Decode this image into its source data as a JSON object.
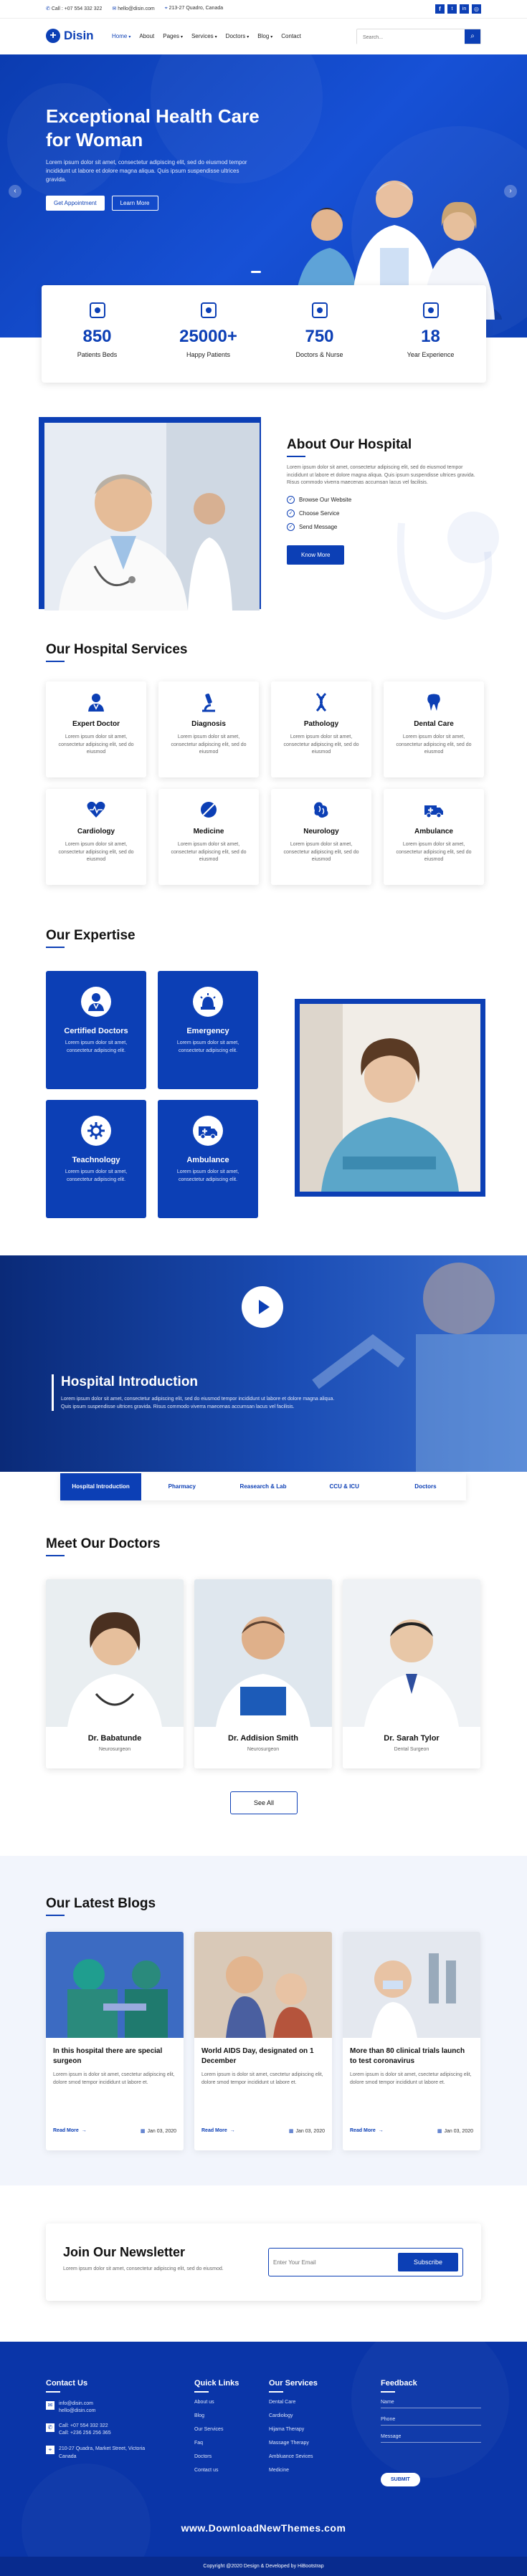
{
  "topbar": {
    "phone": "Call : +07 554 332 322",
    "email": "hello@disin.com",
    "address": "213-27 Quadro, Canada"
  },
  "nav": {
    "logo": "Disin",
    "items": [
      "Home",
      "About",
      "Pages",
      "Services",
      "Doctors",
      "Blog",
      "Contact"
    ],
    "dropdowns": [
      true,
      false,
      true,
      true,
      true,
      true,
      false
    ],
    "search_placeholder": "Search..."
  },
  "hero": {
    "title_line1": "Exceptional Health Care",
    "title_line2": "for Woman",
    "text": "Lorem ipsum dolor sit amet, consectetur adipiscing elit, sed do eiusmod tempor incididunt ut labore et dolore magna aliqua. Quis ipsum suspendisse ultrices gravida.",
    "btn_primary": "Get Appointment",
    "btn_secondary": "Learn More"
  },
  "stats": [
    {
      "value": "850",
      "label": "Patients Beds"
    },
    {
      "value": "25000+",
      "label": "Happy Patients"
    },
    {
      "value": "750",
      "label": "Doctors & Nurse"
    },
    {
      "value": "18",
      "label": "Year Experience"
    }
  ],
  "about": {
    "title": "About Our Hospital",
    "text": "Lorem ipsum dolor sit amet, consectetur adipiscing elit, sed do eiusmod tempor incididunt ut labore et dolore magna aliqua. Quis ipsum suspendisse ultrices gravida. Risus commodo viverra maecenas accumsan lacus vel facilisis.",
    "list": [
      "Browse Our Website",
      "Choose Service",
      "Send Message"
    ],
    "btn": "Know More"
  },
  "services": {
    "title": "Our Hospital Services",
    "desc": "Lorem ipsum dolor sit amet, consectetur adipiscing elit, sed do eiusmod",
    "items": [
      {
        "name": "Expert Doctor",
        "icon": "doctor-icon"
      },
      {
        "name": "Diagnosis",
        "icon": "microscope-icon"
      },
      {
        "name": "Pathology",
        "icon": "dna-icon"
      },
      {
        "name": "Dental Care",
        "icon": "tooth-icon"
      },
      {
        "name": "Cardiology",
        "icon": "heart-icon"
      },
      {
        "name": "Medicine",
        "icon": "pill-icon"
      },
      {
        "name": "Neurology",
        "icon": "brain-icon"
      },
      {
        "name": "Ambulance",
        "icon": "ambulance-icon"
      }
    ]
  },
  "expertise": {
    "title": "Our Expertise",
    "desc": "Lorem ipsum dolor sit amet, consectetur adipiscing elit.",
    "items": [
      {
        "name": "Certified Doctors",
        "icon": "doctor-icon"
      },
      {
        "name": "Emergency",
        "icon": "emergency-icon"
      },
      {
        "name": "Teachnology",
        "icon": "technology-icon"
      },
      {
        "name": "Ambulance",
        "icon": "ambulance-icon"
      }
    ]
  },
  "intro": {
    "title": "Hospital Introduction",
    "text": "Lorem ipsum dolor sit amet, consectetur adipiscing elit, sed do eiusmod tempor incididunt ut labore et dolore magna aliqua. Quis ipsum suspendisse ultrices gravida. Risus commodo viverra maecenas accumsan lacus vel facilisis.",
    "tabs": [
      "Hospital Introduction",
      "Pharmacy",
      "Reasearch & Lab",
      "CCU & ICU",
      "Doctors"
    ]
  },
  "doctors": {
    "title": "Meet Our Doctors",
    "items": [
      {
        "name": "Dr. Babatunde",
        "role": "Neurosurgeon"
      },
      {
        "name": "Dr. Addision Smith",
        "role": "Neurosurgeon"
      },
      {
        "name": "Dr. Sarah Tylor",
        "role": "Dental Surgeon"
      }
    ],
    "see_all": "See All"
  },
  "blogs": {
    "title": "Our Latest Blogs",
    "excerpt": "Lorem ipsum is dolor sit amet, csectetur adipiscing elit, dolore smod tempor incididunt ut labore et.",
    "read_more": "Read More",
    "items": [
      {
        "title": "In this hospital there are special surgeon",
        "date": "Jan 03, 2020"
      },
      {
        "title": "World AIDS Day, designated on 1 December",
        "date": "Jan 03, 2020"
      },
      {
        "title": "More than 80 clinical trials launch to test coronavirus",
        "date": "Jan 03, 2020"
      }
    ]
  },
  "newsletter": {
    "title": "Join Our Newsletter",
    "text": "Lorem ipsum dolor sit amet, consectetur adipiscing elit, sed do eiusmod.",
    "placeholder": "Enter Your Email",
    "btn": "Subscribe"
  },
  "footer": {
    "contact_title": "Contact Us",
    "contact": [
      "info@disin.com",
      "hello@disin.com",
      "Call: +07 554 332 322",
      "Call: +236 256 256 365",
      "210-27 Quadra, Market Street, Victoria Canada"
    ],
    "quick_title": "Quick Links",
    "quick": [
      "About us",
      "Blog",
      "Our Services",
      "Faq",
      "Doctors",
      "Contact us"
    ],
    "services_title": "Our Services",
    "services": [
      "Dental Care",
      "Cardiology",
      "Hijama Therapy",
      "Massage Therapy",
      "Ambluance Sevices",
      "Medicine"
    ],
    "feedback_title": "Feedback",
    "feedback_fields": [
      "Name",
      "Phone",
      "Message"
    ],
    "submit": "SUBMIT",
    "watermark": "www.DownloadNewThemes.com",
    "copyright": "Copyright @2020 Design & Developed by HiBootstrap"
  },
  "colors": {
    "primary": "#0c3fb5",
    "dark": "#0a2f8a",
    "light_bg": "#f2f5fc"
  }
}
